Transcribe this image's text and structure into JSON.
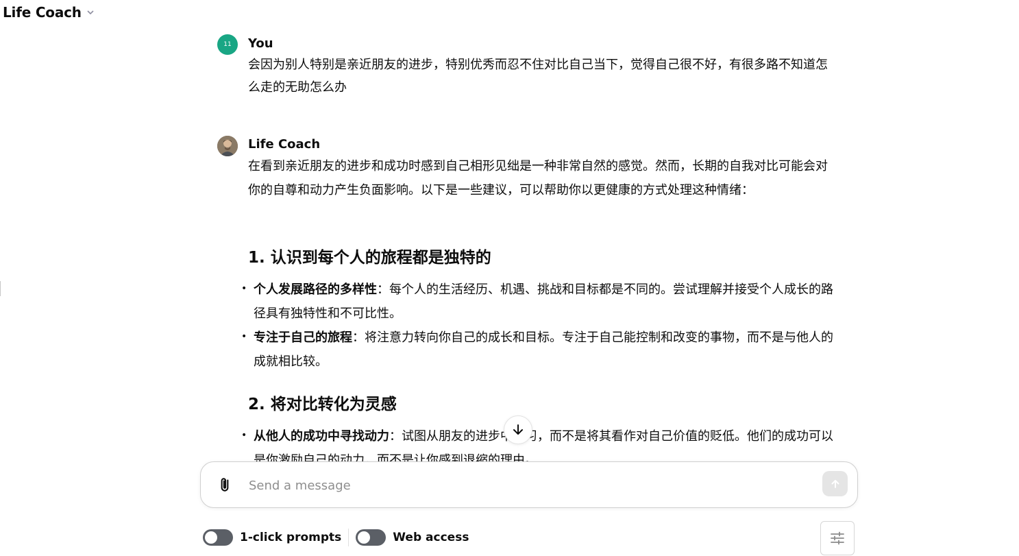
{
  "header": {
    "title": "Life Coach"
  },
  "messages": {
    "user": {
      "avatar_text": "11",
      "author": "You",
      "text": "会因为别人特别是亲近朋友的进步，特别优秀而忍不住对比自己当下，觉得自己很不好，有很多路不知道怎么走的无助怎么办"
    },
    "coach": {
      "author": "Life Coach",
      "intro": "在看到亲近朋友的进步和成功时感到自己相形见绌是一种非常自然的感觉。然而，长期的自我对比可能会对你的自尊和动力产生负面影响。以下是一些建议，可以帮助你以更健康的方式处理这种情绪：",
      "sections": [
        {
          "heading": "1. 认识到每个人的旅程都是独特的",
          "items": [
            {
              "title": "个人发展路径的多样性",
              "text": "：每个人的生活经历、机遇、挑战和目标都是不同的。尝试理解并接受个人成长的路径具有独特性和不可比性。"
            },
            {
              "title": "专注于自己的旅程",
              "text": "：将注意力转向你自己的成长和目标。专注于自己能控制和改变的事物，而不是与他人的成就相比较。"
            }
          ]
        },
        {
          "heading": "2. 将对比转化为灵感",
          "items": [
            {
              "title": "从他人的成功中寻找动力",
              "text": "：试图从朋友的进步中学习，而不是将其看作对自己价值的贬低。他们的成功可以是你激励自己的动力，而不是让你感到退缩的理由。"
            }
          ]
        }
      ]
    }
  },
  "composer": {
    "placeholder": "Send a message"
  },
  "toggles": [
    {
      "label": "1-click prompts",
      "on": false
    },
    {
      "label": "Web access",
      "on": false
    }
  ],
  "icons": {
    "chevron": "chevron-down-icon",
    "attach": "paperclip-icon",
    "send": "arrow-up-icon",
    "scroll": "arrow-down-icon",
    "settings": "sliders-icon"
  }
}
